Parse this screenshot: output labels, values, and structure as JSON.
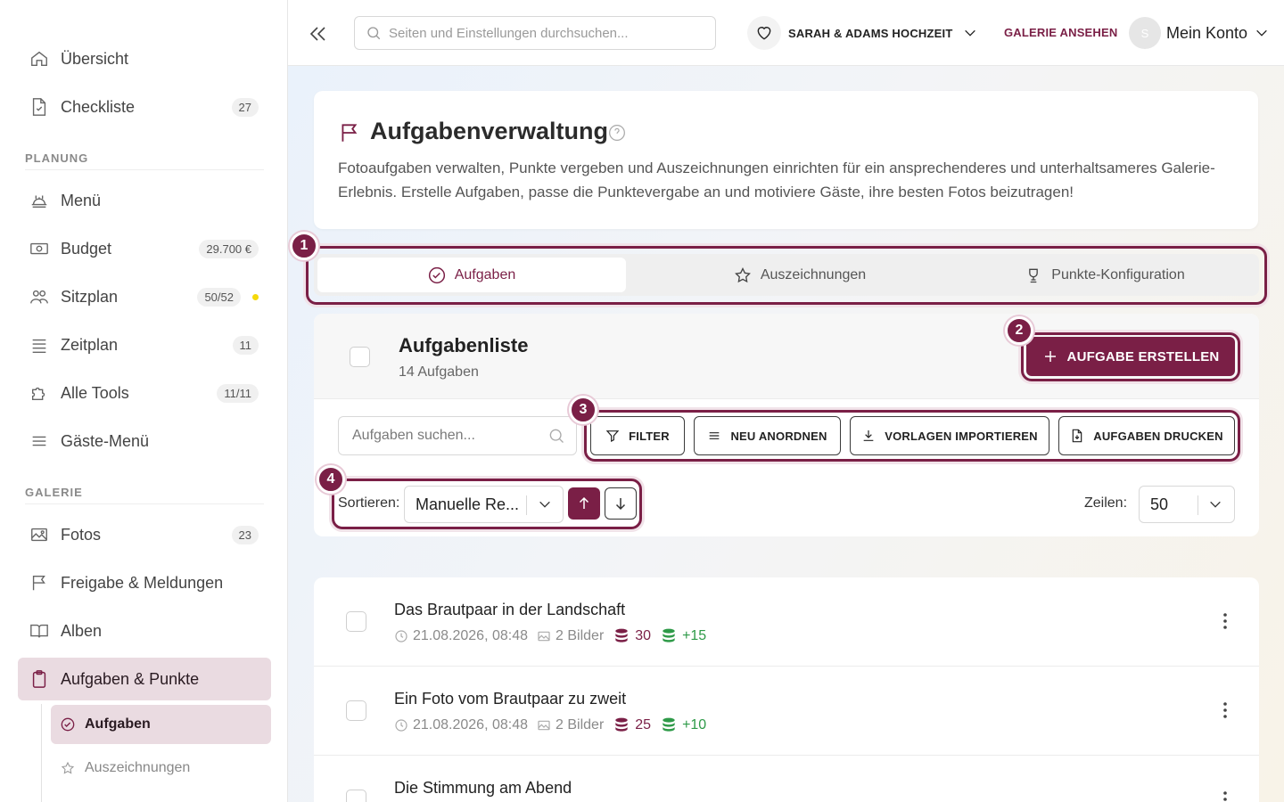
{
  "sidebar": {
    "overview": "Übersicht",
    "checklist": "Checkliste",
    "checklist_badge": "27",
    "section_planning": "PLANUNG",
    "menu": "Menü",
    "budget": "Budget",
    "budget_badge": "29.700 €",
    "seating": "Sitzplan",
    "seating_badge": "50/52",
    "schedule": "Zeitplan",
    "schedule_badge": "11",
    "tools": "Alle Tools",
    "tools_badge": "11/11",
    "guest_menu": "Gäste-Menü",
    "section_gallery": "GALERIE",
    "photos": "Fotos",
    "photos_badge": "23",
    "release": "Freigabe & Meldungen",
    "albums": "Alben",
    "tasks_points": "Aufgaben & Punkte",
    "sub_tasks": "Aufgaben",
    "sub_awards": "Auszeichnungen"
  },
  "topbar": {
    "search_placeholder": "Seiten und Einstellungen durchsuchen...",
    "wedding_name": "SARAH & ADAMS HOCHZEIT",
    "gallery_link": "GALERIE ANSEHEN",
    "avatar_letter": "S",
    "account_label": "Mein Konto"
  },
  "header": {
    "title": "Aufgabenverwaltung",
    "description": "Fotoaufgaben verwalten, Punkte vergeben und Auszeichnungen einrichten für ein ansprechenderes und unterhaltsameres Galerie-Erlebnis. Erstelle Aufgaben, passe die Punktevergabe an und motiviere Gäste, ihre besten Fotos beizutragen!"
  },
  "tabs": [
    {
      "label": "Aufgaben"
    },
    {
      "label": "Auszeichnungen"
    },
    {
      "label": "Punkte-Konfiguration"
    }
  ],
  "list": {
    "title": "Aufgabenliste",
    "count": "14 Aufgaben",
    "create_button": "AUFGABE ERSTELLEN",
    "search_placeholder": "Aufgaben suchen...",
    "filter": "FILTER",
    "reorder": "NEU ANORDNEN",
    "import": "VORLAGEN IMPORTIEREN",
    "print": "AUFGABEN DRUCKEN",
    "sort_label": "Sortieren:",
    "sort_value": "Manuelle Re...",
    "rows_label": "Zeilen:",
    "rows_value": "50"
  },
  "markers": [
    "1",
    "2",
    "3",
    "4"
  ],
  "tasks": [
    {
      "title": "Das Brautpaar in der Landschaft",
      "date": "21.08.2026, 08:48",
      "images": "2 Bilder",
      "points": "30",
      "bonus": "+15"
    },
    {
      "title": "Ein Foto vom Brautpaar zu zweit",
      "date": "21.08.2026, 08:48",
      "images": "2 Bilder",
      "points": "25",
      "bonus": "+10"
    },
    {
      "title": "Die Stimmung am Abend"
    }
  ],
  "colors": {
    "accent": "#7a1f46",
    "active_bg": "#eadbe1",
    "bonus": "#2e9a48",
    "status_dot": "#f5d90a"
  }
}
